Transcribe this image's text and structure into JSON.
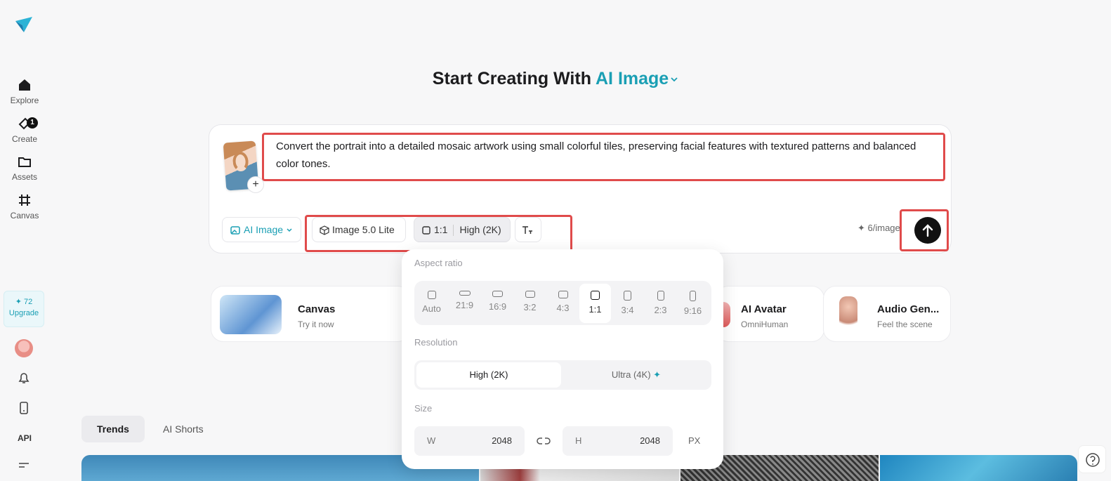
{
  "sidebar": {
    "items": [
      {
        "label": "Explore",
        "icon": "home-icon"
      },
      {
        "label": "Create",
        "icon": "create-icon",
        "badge": "1"
      },
      {
        "label": "Assets",
        "icon": "folder-icon"
      },
      {
        "label": "Canvas",
        "icon": "canvas-icon"
      }
    ],
    "credits": "✦ 72",
    "upgrade_label": "Upgrade",
    "api_label": "API"
  },
  "hero": {
    "title_prefix": "Start Creating With",
    "title_accent": "AI Image"
  },
  "composer": {
    "prompt": "Convert the portrait into a detailed mosaic artwork using small colorful tiles, preserving facial features with textured patterns and balanced color tones.",
    "thumb_add": "+",
    "mode_label": "AI Image",
    "model_label": "Image 5.0 Lite",
    "ratio_label": "1:1",
    "quality_label": "High (2K)",
    "cost_label": "✦ 6/image"
  },
  "cards": [
    {
      "title": "Canvas",
      "subtitle": "Try it now"
    },
    {
      "title": "AI Avatar",
      "subtitle": "OmniHuman"
    },
    {
      "title": "Audio Gen...",
      "subtitle": "Feel the scene"
    }
  ],
  "tabs": [
    "Trends",
    "AI Shorts"
  ],
  "popover": {
    "aspect_label": "Aspect ratio",
    "ratios": [
      "Auto",
      "21:9",
      "16:9",
      "3:2",
      "4:3",
      "1:1",
      "3:4",
      "2:3",
      "9:16"
    ],
    "selected_ratio": "1:1",
    "resolution_label": "Resolution",
    "resolutions": [
      "High (2K)",
      "Ultra (4K)"
    ],
    "selected_resolution": "High (2K)",
    "size_label": "Size",
    "width_key": "W",
    "width_value": "2048",
    "height_key": "H",
    "height_value": "2048",
    "unit": "PX"
  },
  "colors": {
    "accent": "#1a9fb4",
    "highlight": "#e04b4b"
  }
}
